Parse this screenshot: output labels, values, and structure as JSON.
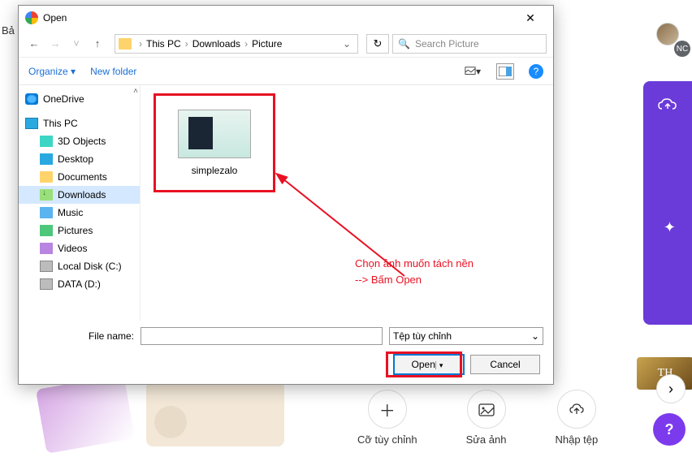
{
  "bg": {
    "truncated_text": "Bả",
    "avatar_initials": "NC",
    "gold_label": "TH"
  },
  "actions": {
    "custom": "Cỡ tùy chỉnh",
    "edit": "Sửa ảnh",
    "import": "Nhập tệp"
  },
  "dialog": {
    "title": "Open",
    "breadcrumb": {
      "root": "This PC",
      "folder1": "Downloads",
      "folder2": "Picture"
    },
    "search_placeholder": "Search Picture",
    "toolbar": {
      "organize": "Organize",
      "new_folder": "New folder"
    },
    "tree": {
      "onedrive": "OneDrive",
      "thispc": "This PC",
      "threed": "3D Objects",
      "desktop": "Desktop",
      "documents": "Documents",
      "downloads": "Downloads",
      "music": "Music",
      "pictures": "Pictures",
      "videos": "Videos",
      "localdisk": "Local Disk (C:)",
      "datadisk": "DATA (D:)"
    },
    "file": {
      "name": "simplezalo"
    },
    "annotation": {
      "line1": "Chọn ảnh muốn tách nền",
      "line2": "--> Bấm Open"
    },
    "footer": {
      "filename_label": "File name:",
      "filetype": "Tệp tùy chỉnh",
      "open": "Open",
      "cancel": "Cancel"
    }
  }
}
